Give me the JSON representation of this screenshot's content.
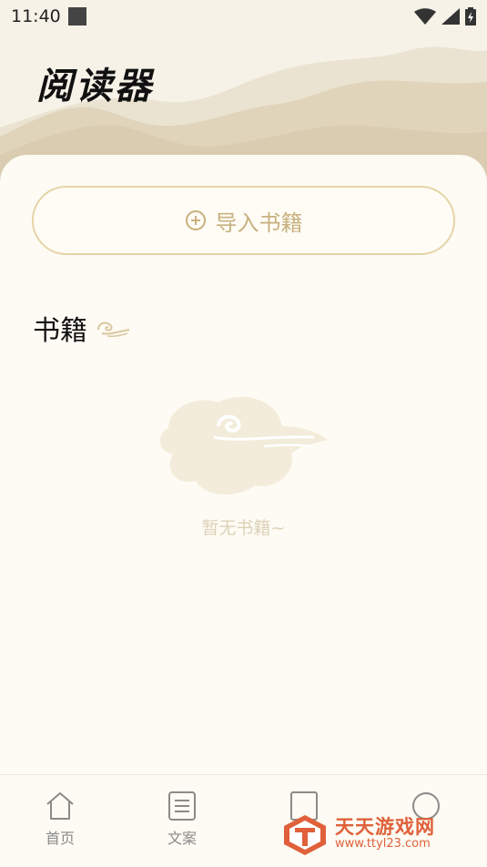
{
  "status_bar": {
    "time": "11:40"
  },
  "header": {
    "title": "阅读器"
  },
  "import_button": {
    "label": "导入书籍"
  },
  "books_section": {
    "title": "书籍"
  },
  "empty_state": {
    "text": "暂无书籍~"
  },
  "bottom_nav": {
    "items": [
      {
        "label": "首页",
        "icon": "home-icon"
      },
      {
        "label": "文案",
        "icon": "document-icon"
      },
      {
        "label": "",
        "icon": "book-icon"
      },
      {
        "label": "",
        "icon": "profile-icon"
      }
    ]
  },
  "watermark": {
    "name": "天天游戏网",
    "url": "www.ttyl23.com"
  },
  "colors": {
    "background": "#fbf8ef",
    "accent": "#c9b07e",
    "border": "#e6d4a8",
    "empty_text": "#ddd2b8",
    "watermark": "#e0603a"
  }
}
